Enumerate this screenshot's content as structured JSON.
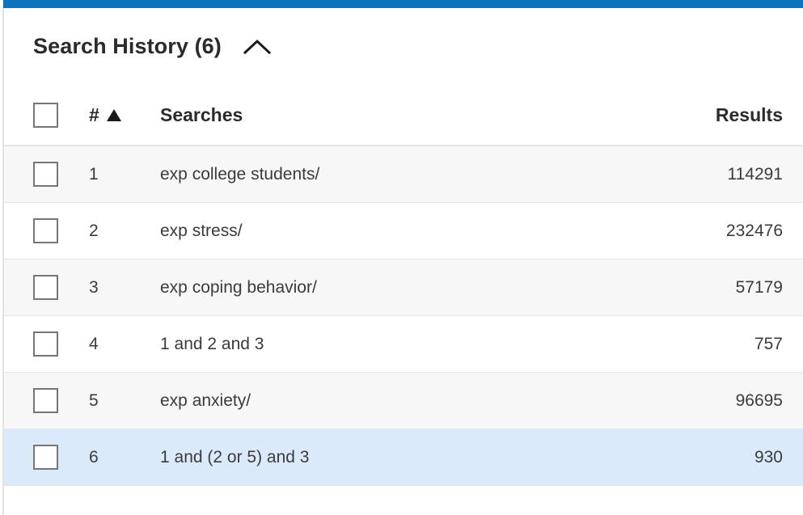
{
  "theme": {
    "accent_bar_color": "#0a74bd",
    "row_stripe_color": "#f7f7f7",
    "row_active_color": "#daeafa",
    "border_color": "#e6e6e6"
  },
  "panel": {
    "title": "Search History (6)",
    "collapse_icon": "chevron-up-icon",
    "collapse_state": "expanded"
  },
  "table": {
    "columns": {
      "select_all": "",
      "number": "#",
      "sort_indicator": "ascending",
      "searches": "Searches",
      "results": "Results"
    },
    "rows": [
      {
        "number": "1",
        "query": "exp college students/",
        "results": "114291",
        "selected": false,
        "highlighted": false
      },
      {
        "number": "2",
        "query": "exp stress/",
        "results": "232476",
        "selected": false,
        "highlighted": false
      },
      {
        "number": "3",
        "query": "exp coping behavior/",
        "results": "57179",
        "selected": false,
        "highlighted": false
      },
      {
        "number": "4",
        "query": "1 and 2 and 3",
        "results": "757",
        "selected": false,
        "highlighted": false
      },
      {
        "number": "5",
        "query": "exp anxiety/",
        "results": "96695",
        "selected": false,
        "highlighted": false
      },
      {
        "number": "6",
        "query": "1 and (2 or 5) and 3",
        "results": "930",
        "selected": false,
        "highlighted": true
      }
    ]
  }
}
